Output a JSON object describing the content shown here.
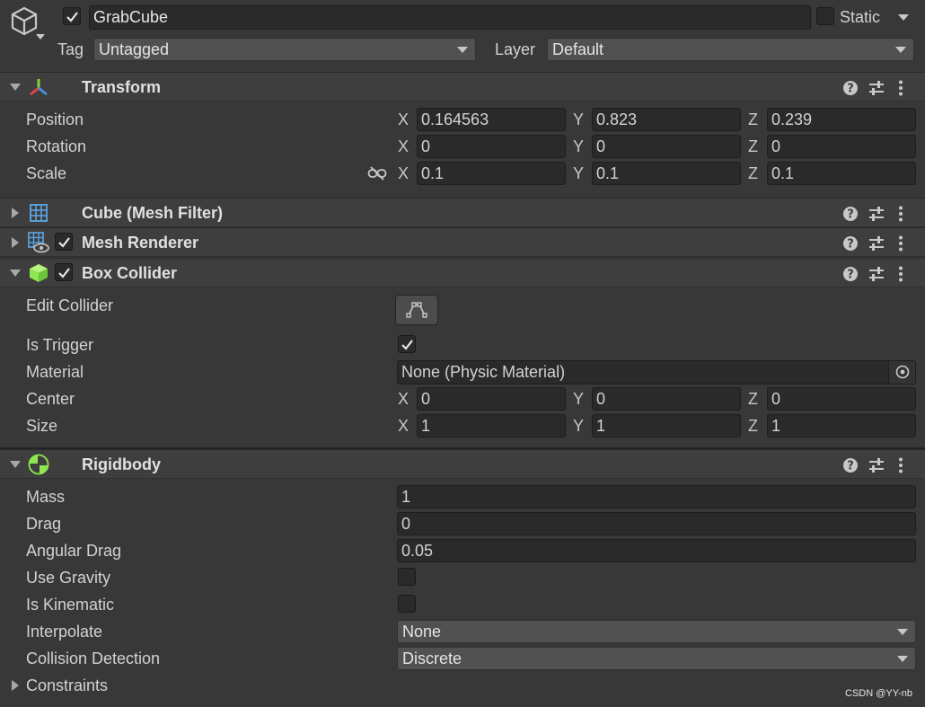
{
  "object": {
    "name": "GrabCube",
    "active": true,
    "static_label": "Static",
    "static": false,
    "tag_label": "Tag",
    "tag_value": "Untagged",
    "layer_label": "Layer",
    "layer_value": "Default"
  },
  "transform": {
    "title": "Transform",
    "rows": [
      {
        "label": "Position",
        "x": "0.164563",
        "y": "0.823",
        "z": "0.239"
      },
      {
        "label": "Rotation",
        "x": "0",
        "y": "0",
        "z": "0"
      },
      {
        "label": "Scale",
        "x": "0.1",
        "y": "0.1",
        "z": "0.1"
      }
    ]
  },
  "mesh_filter": {
    "title": "Cube (Mesh Filter)"
  },
  "mesh_renderer": {
    "title": "Mesh Renderer",
    "enabled": true
  },
  "box_collider": {
    "title": "Box Collider",
    "enabled": true,
    "edit_collider_label": "Edit Collider",
    "is_trigger_label": "Is Trigger",
    "is_trigger": true,
    "material_label": "Material",
    "material_value": "None (Physic Material)",
    "center_label": "Center",
    "center": {
      "x": "0",
      "y": "0",
      "z": "0"
    },
    "size_label": "Size",
    "size": {
      "x": "1",
      "y": "1",
      "z": "1"
    }
  },
  "rigidbody": {
    "title": "Rigidbody",
    "mass_label": "Mass",
    "mass": "1",
    "drag_label": "Drag",
    "drag": "0",
    "angular_drag_label": "Angular Drag",
    "angular_drag": "0.05",
    "use_gravity_label": "Use Gravity",
    "use_gravity": false,
    "is_kinematic_label": "Is Kinematic",
    "is_kinematic": false,
    "interpolate_label": "Interpolate",
    "interpolate": "None",
    "collision_detection_label": "Collision Detection",
    "collision_detection": "Discrete",
    "constraints_label": "Constraints"
  },
  "axes": {
    "x": "X",
    "y": "Y",
    "z": "Z"
  },
  "watermark": "CSDN @YY-nb",
  "icons": {
    "object": "cube-outline-icon",
    "transform": "transform-axes-icon",
    "mesh_filter": "mesh-grid-icon",
    "mesh_renderer": "mesh-renderer-icon",
    "box_collider": "green-cube-icon",
    "rigidbody": "rigidbody-sphere-icon",
    "help": "help-icon",
    "presets": "sliders-icon",
    "more": "kebab-menu-icon",
    "link": "constrain-proportions-icon",
    "edit_collider": "edit-bounds-icon",
    "object_picker": "object-picker-icon"
  },
  "colors": {
    "background": "#383838",
    "field": "#2a2a2a",
    "header": "#3e3e3e",
    "accent_green": "#8fe84f"
  }
}
